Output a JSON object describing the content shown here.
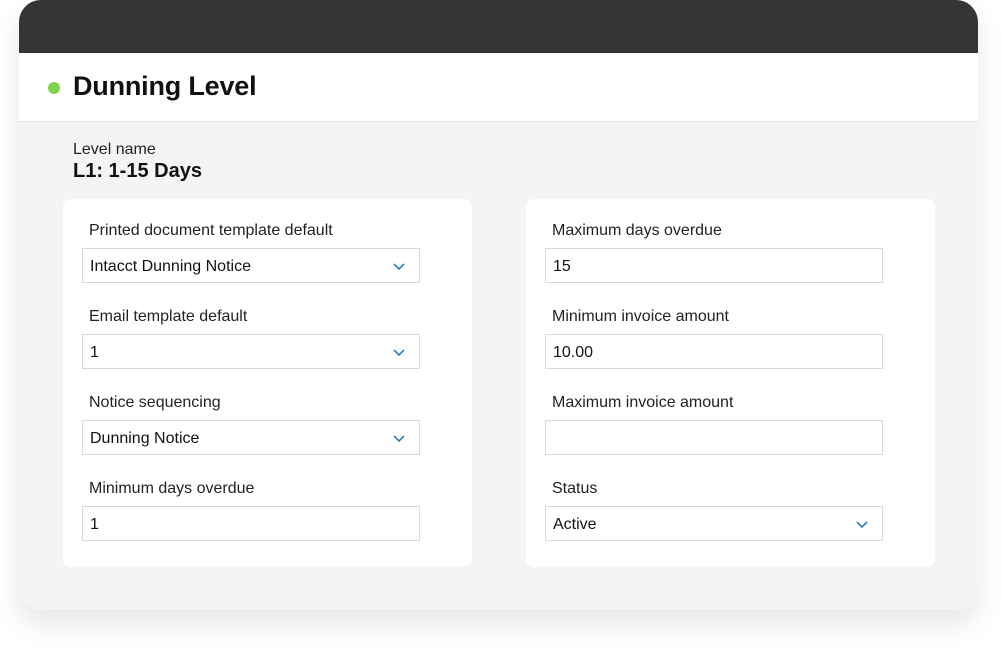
{
  "header": {
    "title": "Dunning Level",
    "status_color": "#7ed34c"
  },
  "level": {
    "label": "Level name",
    "value": "L1: 1-15 Days"
  },
  "left_card": {
    "fields": [
      {
        "label": "Printed document template default",
        "value": "Intacct Dunning Notice",
        "type": "select"
      },
      {
        "label": "Email template default",
        "value": "1",
        "type": "select"
      },
      {
        "label": "Notice sequencing",
        "value": "Dunning Notice",
        "type": "select"
      },
      {
        "label": "Minimum days overdue",
        "value": "1",
        "type": "input"
      }
    ]
  },
  "right_card": {
    "fields": [
      {
        "label": "Maximum days overdue",
        "value": "15",
        "type": "input"
      },
      {
        "label": "Minimum invoice amount",
        "value": "10.00",
        "type": "input"
      },
      {
        "label": "Maximum invoice amount",
        "value": "",
        "type": "input"
      },
      {
        "label": "Status",
        "value": "Active",
        "type": "select"
      }
    ]
  },
  "colors": {
    "topbar": "#353535",
    "accent_chevron": "#2f7fb5"
  }
}
